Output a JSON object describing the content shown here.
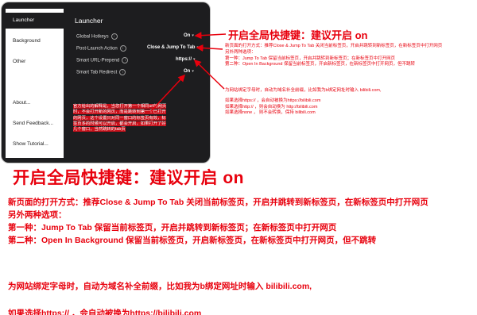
{
  "window": {
    "sidebar": {
      "items": [
        "Launcher",
        "Background",
        "Other",
        "About...",
        "Send Feedback...",
        "Show Tutorial..."
      ],
      "active_index": 0
    },
    "panel_title": "Launcher",
    "rows": [
      {
        "label": "Global Hotkeys",
        "value": "On"
      },
      {
        "label": "Post-Launch Action",
        "value": "Close & Jump To Tab"
      },
      {
        "label": "Smart URL-Prepend",
        "value": "https://"
      },
      {
        "label": "Smart Tab Redirect",
        "value": "On"
      }
    ],
    "overlay_note": "官方给出的解释是，当您打开第一个相同url的网页时，不会打开新的网页，而是跳转到第一个已打开的网页，这个设置只对同一窗口的标签页有效，标签页多的时候可以开启，都会开启，如果打开了好几个窗口，当然跳转的tab页"
  },
  "annotations": {
    "hotkeys": "开启全局快捷键：建议开启 on",
    "post_launch_small": [
      "新页面的打开方式：推荐Close & Jump To Tab 关闭当前标签页，开启并跳转到新标签页，在新标签页中打开网页",
      "另外两种选项：",
      "第一种：Jump To Tab 保留当前标签页，开启并跳转到新标签页；在新标签页中打开网页",
      "第二种：Open In Background 保留当前标签页，开启新标签页，在新标签页中打开网页，但不跳转"
    ],
    "prepend_small": [
      "为网站绑定字母时，自动为域名补全前缀，比如我为b绑定网址时输入 bilibili.com,",
      "如果选择https:// ，会自动被换为https://bilibili.com",
      "如果选择http:// ，则会自动换为 http://bilibili.com",
      "如果选择none ， 则不会转换，保持 bilibili.com"
    ],
    "big_heading": "开启全局快捷键：建议开启 on",
    "big_para_lines": [
      "新页面的打开方式：推荐Close & Jump To Tab 关闭当前标签页，开启并跳转到新标签页，在新标签页中打开网页",
      "另外两种选项：",
      "第一种：Jump To Tab 保留当前标签页，开启并跳转到新标签页；在新标签页中打开网页",
      "第二种：Open In Background 保留当前标签页，开启新标签页，在新标签页中打开网页，但不跳转"
    ],
    "big_prepend": "为网站绑定字母时，自动为域名补全前缀，比如我为b绑定网址时输入 bilibili.com,",
    "big_cut": "如果选择https:// ，会自动被换为https://bilibili.com"
  },
  "colors": {
    "annotation_red": "#e8000d",
    "window_bg": "#1d1d1f"
  }
}
